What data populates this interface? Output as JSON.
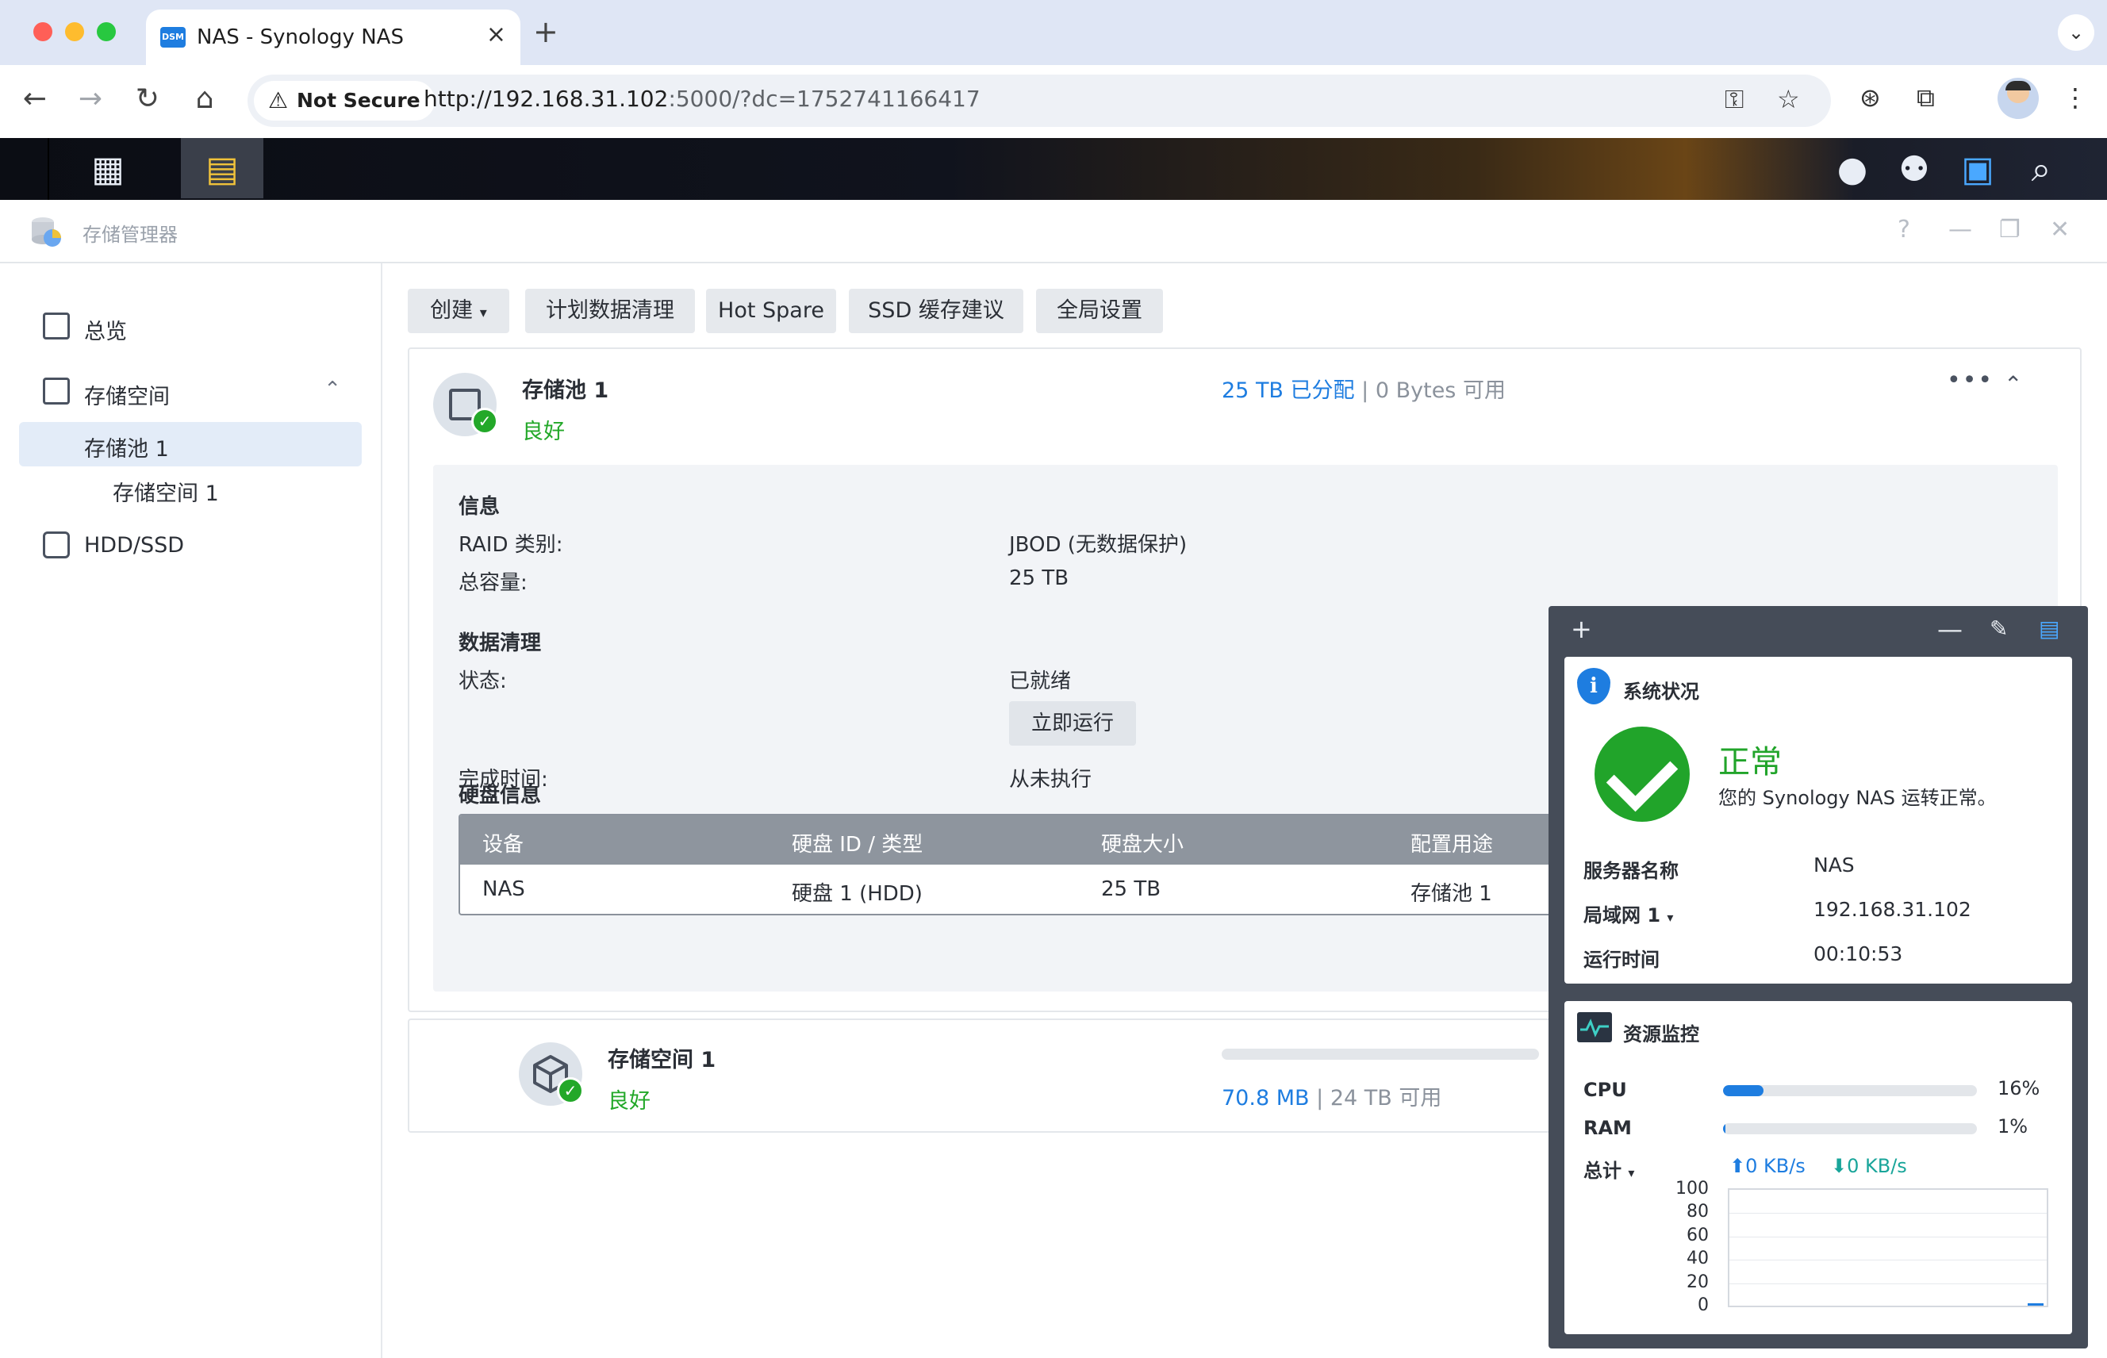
{
  "browser": {
    "tab_title": "NAS - Synology NAS",
    "tab_favicon_text": "DSM",
    "security_label": "Not Secure",
    "url_host": "http://192.168.31.102",
    "url_rest": ":5000/?dc=1752741166417"
  },
  "window": {
    "app_name": "存储管理器"
  },
  "sidebar": {
    "items": [
      {
        "label": "总览"
      },
      {
        "label": "存储空间"
      },
      {
        "label": "存储池 1"
      },
      {
        "label": "存储空间 1"
      },
      {
        "label": "HDD/SSD"
      }
    ]
  },
  "toolbar": {
    "create_label": "创建",
    "schedule_scrub_label": "计划数据清理",
    "hot_spare_label": "Hot Spare",
    "ssd_cache_label": "SSD 缓存建议",
    "global_settings_label": "全局设置"
  },
  "pool": {
    "title": "存储池 1",
    "status": "良好",
    "allocated": "25 TB 已分配",
    "separator": "|",
    "available": "0 Bytes 可用",
    "info_title": "信息",
    "raid_key": "RAID 类别:",
    "raid_val": "JBOD (无数据保护)",
    "capacity_key": "总容量:",
    "capacity_val": "25 TB",
    "scrub_title": "数据清理",
    "state_key": "状态:",
    "state_val": "已就绪",
    "run_now_label": "立即运行",
    "completed_key": "完成时间:",
    "completed_val": "从未执行",
    "disk_title": "硬盘信息",
    "disk_columns": [
      "设备",
      "硬盘 ID / 类型",
      "硬盘大小",
      "配置用途"
    ],
    "disk_rows": [
      [
        "NAS",
        "硬盘 1 (HDD)",
        "25 TB",
        "存储池 1"
      ]
    ]
  },
  "volume": {
    "title": "存储空间 1",
    "status": "良好",
    "used": "70.8 MB",
    "separator": "|",
    "available": "24 TB 可用"
  },
  "widget": {
    "system_status": {
      "title": "系统状况",
      "state": "正常",
      "description": "您的 Synology NAS 运转正常。",
      "server_name_key": "服务器名称",
      "server_name_val": "NAS",
      "lan_key": "局域网 1",
      "lan_val": "192.168.31.102",
      "uptime_key": "运行时间",
      "uptime_val": "00:10:53"
    },
    "resource_monitor": {
      "title": "资源监控",
      "cpu_label": "CPU",
      "cpu_pct": "16%",
      "cpu_value": 16,
      "ram_label": "RAM",
      "ram_pct": "1%",
      "ram_value": 1,
      "total_label": "总计",
      "upload": "0 KB/s",
      "download": "0 KB/s",
      "y_ticks": [
        "100",
        "80",
        "60",
        "40",
        "20",
        "0"
      ]
    }
  },
  "colors": {
    "accent_blue": "#1e7de0",
    "success_green": "#23a829",
    "widget_bg": "#454c58"
  }
}
